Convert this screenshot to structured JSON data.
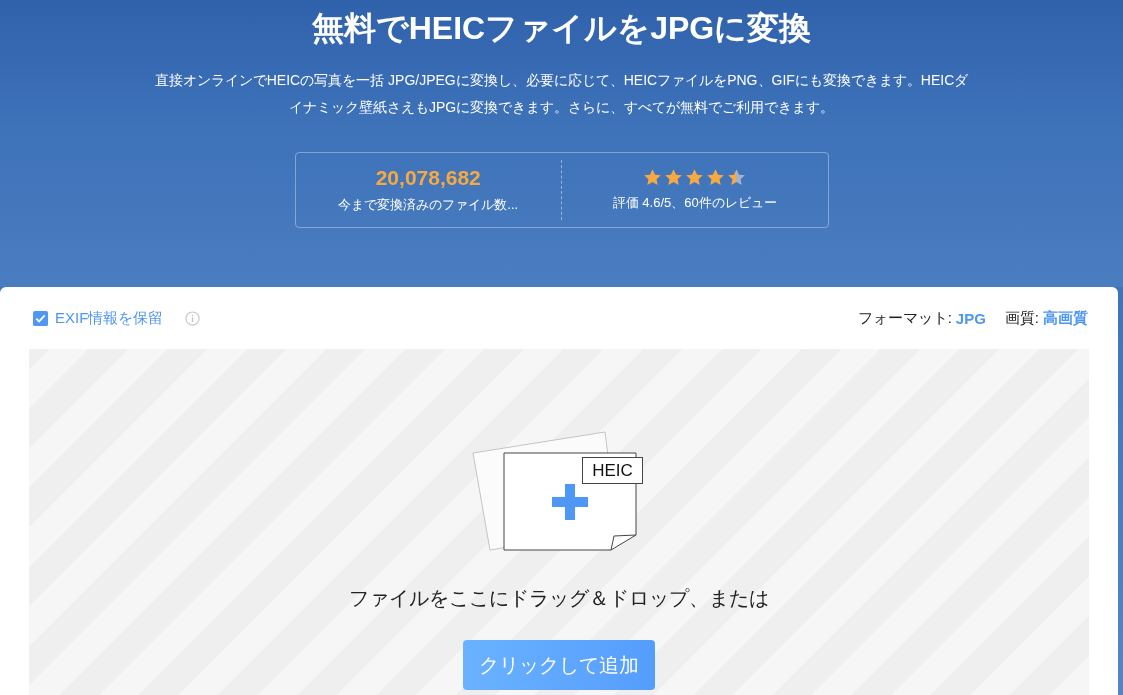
{
  "hero": {
    "title": "無料でHEICファイルをJPGに変換",
    "description": "直接オンラインでHEICの写真を一括 JPG/JPEGに変換し、必要に応じて、HEICファイルをPNG、GIFにも変換できます。HEICダイナミック壁紙さえもJPGに変換できます。さらに、すべてが無料でご利用できます。",
    "stats": {
      "count": "20,078,682",
      "count_label": "今まで変換済みのファイル数...",
      "stars": 4.5,
      "rating_label": "評価 4.6/5、60件のレビュー"
    }
  },
  "converter": {
    "keep_exif": {
      "label": "EXIF情報を保留",
      "checked": true
    },
    "format": {
      "label": "フォーマット:",
      "value": "JPG"
    },
    "quality": {
      "label": "画質:",
      "value": "高画質"
    },
    "dropzone": {
      "file_type": "HEIC",
      "instruction": "ファイルをここにドラッグ＆ドロップ、または",
      "button": "クリックして追加"
    }
  }
}
